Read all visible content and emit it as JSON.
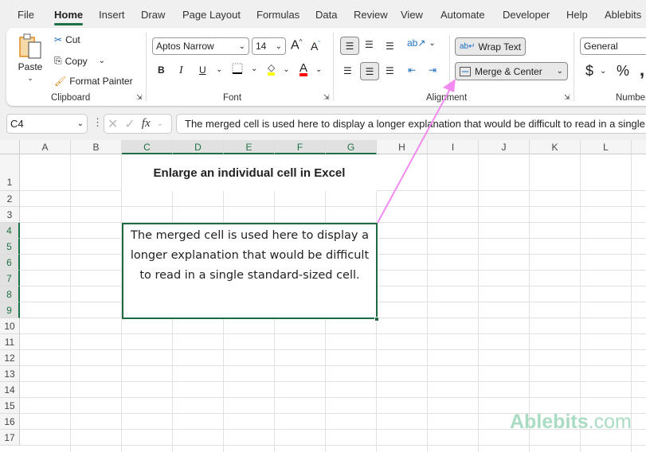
{
  "tabs": [
    "File",
    "Home",
    "Insert",
    "Draw",
    "Page Layout",
    "Formulas",
    "Data",
    "Review",
    "View",
    "Automate",
    "Developer",
    "Help",
    "Ablebits"
  ],
  "active_tab": "Home",
  "clipboard": {
    "paste": "Paste",
    "cut": "Cut",
    "copy": "Copy",
    "format_painter": "Format Painter",
    "label": "Clipboard"
  },
  "font": {
    "name": "Aptos Narrow",
    "size": "14",
    "bold": "B",
    "italic": "I",
    "underline": "U",
    "label": "Font",
    "fill_color": "#ffff00",
    "font_color": "#ff0000"
  },
  "alignment": {
    "wrap_text": "Wrap Text",
    "merge_center": "Merge & Center",
    "label": "Alignment"
  },
  "number": {
    "format": "General",
    "currency": "$",
    "percent": "%",
    "comma": ",",
    "label": "Number"
  },
  "formula_bar": {
    "name_box": "C4",
    "fx": "fx",
    "content": "The merged cell is used here to display a longer explanation that would be difficult to read in a single standard-sized cell."
  },
  "columns": [
    "A",
    "B",
    "C",
    "D",
    "E",
    "F",
    "G",
    "H",
    "I",
    "J",
    "K",
    "L"
  ],
  "rows": [
    "1",
    "2",
    "3",
    "4",
    "5",
    "6",
    "7",
    "8",
    "9",
    "10",
    "11",
    "12",
    "13",
    "14",
    "15",
    "16",
    "17"
  ],
  "cells": {
    "title": "Enlarge an individual cell in Excel",
    "merged": "The merged cell is used here to display a longer explanation that would be difficult to read in a single standard-sized cell."
  },
  "watermark": "Ablebits.com",
  "colors": {
    "accent": "#1e7145",
    "arrow": "#f28af2"
  }
}
